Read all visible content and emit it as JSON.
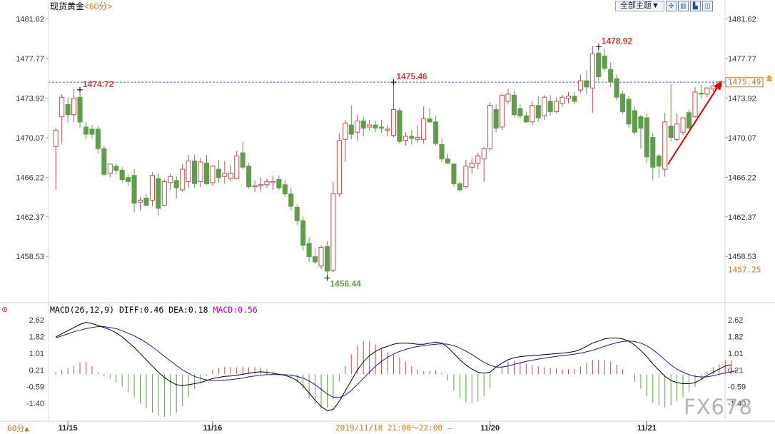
{
  "instrument": {
    "name": "现货黄金",
    "period": "<60分>"
  },
  "toolbar": {
    "theme_label": "全部主题▼",
    "buttons": [
      "✣",
      "▥",
      "▙",
      "◫"
    ]
  },
  "colors": {
    "up": "#c0504d",
    "down": "#5e9e4a",
    "diff": "#000000",
    "dea": "#1a1a9c",
    "macd": "#cc00cc",
    "last_price": "#c8781e",
    "guide": "#3a6fd8",
    "arrow": "#e00000"
  },
  "macd_label": {
    "prefix": "MACD(26,12,9)",
    "diff": "DIFF:0.46",
    "dea": "DEA:0.18",
    "macd": "MACD:0.56"
  },
  "footer": {
    "period_badge": "60分▲",
    "time_range": "2019/11/18 21:00～22:00 —"
  },
  "watermark": "FX678",
  "chart_data": [
    {
      "type": "candlestick",
      "title": "现货黄金",
      "y_ticks": [
        "1481.62",
        "1477.77",
        "1473.92",
        "1470.07",
        "1466.22",
        "1462.37",
        "1458.53"
      ],
      "ylim": [
        1455.7,
        1482.2
      ],
      "x_labels": [
        "11/15",
        "11/16",
        "11/20",
        "11/21"
      ],
      "last_price": "1475.49",
      "lowest_label": "1457.25",
      "reference_line": 1475.46,
      "annotations": [
        {
          "text": "1474.72",
          "value": 1474.72,
          "kind": "high"
        },
        {
          "text": "1475.46",
          "value": 1475.46,
          "kind": "high"
        },
        {
          "text": "1478.92",
          "value": 1478.92,
          "kind": "high"
        },
        {
          "text": "1456.44",
          "value": 1456.44,
          "kind": "low"
        }
      ],
      "candles": [
        {
          "o": 1469.2,
          "h": 1471.0,
          "l": 1465.0,
          "c": 1470.8
        },
        {
          "o": 1472.1,
          "h": 1474.3,
          "l": 1469.5,
          "c": 1474.0
        },
        {
          "o": 1473.3,
          "h": 1474.0,
          "l": 1471.5,
          "c": 1472.3
        },
        {
          "o": 1472.3,
          "h": 1474.8,
          "l": 1471.6,
          "c": 1473.9
        },
        {
          "o": 1474.0,
          "h": 1474.72,
          "l": 1471.0,
          "c": 1471.6
        },
        {
          "o": 1471.1,
          "h": 1471.6,
          "l": 1469.9,
          "c": 1470.4
        },
        {
          "o": 1470.9,
          "h": 1471.3,
          "l": 1470.0,
          "c": 1470.4
        },
        {
          "o": 1470.9,
          "h": 1471.2,
          "l": 1468.5,
          "c": 1469.0
        },
        {
          "o": 1469.0,
          "h": 1469.3,
          "l": 1466.3,
          "c": 1466.5
        },
        {
          "o": 1466.6,
          "h": 1467.5,
          "l": 1466.2,
          "c": 1467.5
        },
        {
          "o": 1467.3,
          "h": 1467.6,
          "l": 1466.5,
          "c": 1466.9
        },
        {
          "o": 1466.9,
          "h": 1467.2,
          "l": 1465.7,
          "c": 1466.0
        },
        {
          "o": 1466.2,
          "h": 1466.5,
          "l": 1465.4,
          "c": 1465.8
        },
        {
          "o": 1466.4,
          "h": 1467.0,
          "l": 1462.8,
          "c": 1463.7
        },
        {
          "o": 1463.8,
          "h": 1464.3,
          "l": 1463.0,
          "c": 1464.0
        },
        {
          "o": 1464.2,
          "h": 1464.6,
          "l": 1463.4,
          "c": 1463.5
        },
        {
          "o": 1464.0,
          "h": 1466.7,
          "l": 1463.4,
          "c": 1466.4
        },
        {
          "o": 1466.1,
          "h": 1466.6,
          "l": 1462.5,
          "c": 1463.2
        },
        {
          "o": 1463.5,
          "h": 1466.0,
          "l": 1463.4,
          "c": 1465.8
        },
        {
          "o": 1465.7,
          "h": 1466.6,
          "l": 1465.0,
          "c": 1466.3
        },
        {
          "o": 1465.9,
          "h": 1466.3,
          "l": 1464.2,
          "c": 1465.2
        },
        {
          "o": 1465.0,
          "h": 1467.5,
          "l": 1464.8,
          "c": 1467.0
        },
        {
          "o": 1465.8,
          "h": 1468.4,
          "l": 1465.2,
          "c": 1467.8
        },
        {
          "o": 1467.8,
          "h": 1468.4,
          "l": 1465.2,
          "c": 1465.6
        },
        {
          "o": 1465.8,
          "h": 1468.1,
          "l": 1465.3,
          "c": 1467.7
        },
        {
          "o": 1467.6,
          "h": 1468.4,
          "l": 1465.5,
          "c": 1465.6
        },
        {
          "o": 1465.7,
          "h": 1467.4,
          "l": 1465.4,
          "c": 1467.3
        },
        {
          "o": 1467.0,
          "h": 1467.9,
          "l": 1465.7,
          "c": 1466.2
        },
        {
          "o": 1466.3,
          "h": 1467.8,
          "l": 1465.6,
          "c": 1466.6
        },
        {
          "o": 1466.1,
          "h": 1467.4,
          "l": 1465.8,
          "c": 1466.6
        },
        {
          "o": 1466.1,
          "h": 1468.8,
          "l": 1466.0,
          "c": 1468.3
        },
        {
          "o": 1468.6,
          "h": 1469.7,
          "l": 1467.0,
          "c": 1467.2
        },
        {
          "o": 1467.3,
          "h": 1467.6,
          "l": 1465.1,
          "c": 1465.3
        },
        {
          "o": 1465.3,
          "h": 1465.9,
          "l": 1464.8,
          "c": 1465.4
        },
        {
          "o": 1465.4,
          "h": 1466.2,
          "l": 1464.9,
          "c": 1465.5
        },
        {
          "o": 1465.5,
          "h": 1466.1,
          "l": 1465.2,
          "c": 1465.8
        },
        {
          "o": 1465.7,
          "h": 1466.3,
          "l": 1465.0,
          "c": 1465.8
        },
        {
          "o": 1466.0,
          "h": 1466.4,
          "l": 1465.0,
          "c": 1465.2
        },
        {
          "o": 1465.5,
          "h": 1466.0,
          "l": 1464.3,
          "c": 1464.6
        },
        {
          "o": 1464.6,
          "h": 1465.2,
          "l": 1463.0,
          "c": 1463.4
        },
        {
          "o": 1463.3,
          "h": 1463.6,
          "l": 1461.6,
          "c": 1462.0
        },
        {
          "o": 1462.0,
          "h": 1462.4,
          "l": 1459.1,
          "c": 1459.6
        },
        {
          "o": 1459.8,
          "h": 1460.4,
          "l": 1458.0,
          "c": 1458.5
        },
        {
          "o": 1458.5,
          "h": 1459.3,
          "l": 1457.8,
          "c": 1458.0
        },
        {
          "o": 1457.6,
          "h": 1459.6,
          "l": 1457.3,
          "c": 1459.4
        },
        {
          "o": 1459.5,
          "h": 1460.0,
          "l": 1456.44,
          "c": 1457.1
        },
        {
          "o": 1457.2,
          "h": 1465.8,
          "l": 1457.0,
          "c": 1464.6
        },
        {
          "o": 1464.6,
          "h": 1470.5,
          "l": 1464.3,
          "c": 1469.8
        },
        {
          "o": 1469.9,
          "h": 1471.8,
          "l": 1467.7,
          "c": 1471.5
        },
        {
          "o": 1471.3,
          "h": 1473.2,
          "l": 1469.9,
          "c": 1470.4
        },
        {
          "o": 1470.6,
          "h": 1472.3,
          "l": 1469.8,
          "c": 1471.7
        },
        {
          "o": 1471.7,
          "h": 1472.1,
          "l": 1470.2,
          "c": 1471.0
        },
        {
          "o": 1471.1,
          "h": 1471.8,
          "l": 1470.8,
          "c": 1471.3
        },
        {
          "o": 1471.3,
          "h": 1471.7,
          "l": 1470.6,
          "c": 1471.0
        },
        {
          "o": 1471.1,
          "h": 1471.8,
          "l": 1470.5,
          "c": 1471.0
        },
        {
          "o": 1470.8,
          "h": 1471.3,
          "l": 1470.2,
          "c": 1470.9
        },
        {
          "o": 1470.3,
          "h": 1475.46,
          "l": 1470.1,
          "c": 1472.8
        },
        {
          "o": 1472.7,
          "h": 1473.0,
          "l": 1469.5,
          "c": 1469.7
        },
        {
          "o": 1469.8,
          "h": 1470.6,
          "l": 1469.3,
          "c": 1470.2
        },
        {
          "o": 1470.2,
          "h": 1470.8,
          "l": 1469.4,
          "c": 1470.0
        },
        {
          "o": 1469.9,
          "h": 1471.3,
          "l": 1469.6,
          "c": 1470.1
        },
        {
          "o": 1469.9,
          "h": 1473.1,
          "l": 1469.5,
          "c": 1471.9
        },
        {
          "o": 1471.9,
          "h": 1472.9,
          "l": 1471.5,
          "c": 1471.6
        },
        {
          "o": 1471.6,
          "h": 1472.2,
          "l": 1469.3,
          "c": 1469.5
        },
        {
          "o": 1469.4,
          "h": 1470.0,
          "l": 1467.7,
          "c": 1468.0
        },
        {
          "o": 1468.0,
          "h": 1468.5,
          "l": 1467.5,
          "c": 1467.6
        },
        {
          "o": 1467.5,
          "h": 1467.6,
          "l": 1465.3,
          "c": 1465.6
        },
        {
          "o": 1465.6,
          "h": 1465.8,
          "l": 1464.8,
          "c": 1465.0
        },
        {
          "o": 1465.3,
          "h": 1467.9,
          "l": 1465.1,
          "c": 1467.3
        },
        {
          "o": 1467.2,
          "h": 1468.1,
          "l": 1466.6,
          "c": 1467.6
        },
        {
          "o": 1467.6,
          "h": 1468.6,
          "l": 1467.0,
          "c": 1468.3
        },
        {
          "o": 1468.0,
          "h": 1469.2,
          "l": 1465.8,
          "c": 1469.0
        },
        {
          "o": 1469.0,
          "h": 1473.5,
          "l": 1468.8,
          "c": 1473.2
        },
        {
          "o": 1472.8,
          "h": 1473.3,
          "l": 1470.6,
          "c": 1471.0
        },
        {
          "o": 1471.1,
          "h": 1474.4,
          "l": 1470.8,
          "c": 1474.2
        },
        {
          "o": 1473.6,
          "h": 1474.8,
          "l": 1473.3,
          "c": 1474.3
        },
        {
          "o": 1474.2,
          "h": 1474.6,
          "l": 1472.1,
          "c": 1472.3
        },
        {
          "o": 1472.9,
          "h": 1473.3,
          "l": 1471.9,
          "c": 1472.2
        },
        {
          "o": 1472.2,
          "h": 1472.6,
          "l": 1471.5,
          "c": 1471.6
        },
        {
          "o": 1471.6,
          "h": 1473.6,
          "l": 1471.3,
          "c": 1473.2
        },
        {
          "o": 1473.2,
          "h": 1474.1,
          "l": 1471.6,
          "c": 1472.0
        },
        {
          "o": 1472.2,
          "h": 1474.2,
          "l": 1471.8,
          "c": 1474.0
        },
        {
          "o": 1473.6,
          "h": 1474.2,
          "l": 1472.2,
          "c": 1472.6
        },
        {
          "o": 1472.6,
          "h": 1474.0,
          "l": 1472.4,
          "c": 1473.6
        },
        {
          "o": 1473.4,
          "h": 1474.2,
          "l": 1473.1,
          "c": 1474.0
        },
        {
          "o": 1473.9,
          "h": 1474.5,
          "l": 1473.4,
          "c": 1474.1
        },
        {
          "o": 1474.1,
          "h": 1474.5,
          "l": 1473.3,
          "c": 1473.6
        },
        {
          "o": 1474.7,
          "h": 1476.2,
          "l": 1474.4,
          "c": 1475.6
        },
        {
          "o": 1475.6,
          "h": 1476.6,
          "l": 1474.3,
          "c": 1475.0
        },
        {
          "o": 1474.9,
          "h": 1479.0,
          "l": 1472.5,
          "c": 1478.2
        },
        {
          "o": 1478.3,
          "h": 1478.92,
          "l": 1475.6,
          "c": 1476.0
        },
        {
          "o": 1478.0,
          "h": 1478.7,
          "l": 1476.5,
          "c": 1476.8
        },
        {
          "o": 1476.7,
          "h": 1477.4,
          "l": 1475.0,
          "c": 1475.5
        },
        {
          "o": 1475.8,
          "h": 1476.2,
          "l": 1473.7,
          "c": 1474.0
        },
        {
          "o": 1474.3,
          "h": 1474.6,
          "l": 1472.4,
          "c": 1472.6
        },
        {
          "o": 1473.8,
          "h": 1474.1,
          "l": 1471.0,
          "c": 1471.4
        },
        {
          "o": 1472.7,
          "h": 1473.1,
          "l": 1470.4,
          "c": 1470.6
        },
        {
          "o": 1472.1,
          "h": 1472.3,
          "l": 1469.0,
          "c": 1471.0
        },
        {
          "o": 1472.0,
          "h": 1472.4,
          "l": 1467.6,
          "c": 1468.2
        },
        {
          "o": 1470.1,
          "h": 1470.5,
          "l": 1466.0,
          "c": 1467.2
        },
        {
          "o": 1468.3,
          "h": 1468.5,
          "l": 1466.2,
          "c": 1467.3
        },
        {
          "o": 1467.0,
          "h": 1472.5,
          "l": 1466.3,
          "c": 1471.6
        },
        {
          "o": 1471.2,
          "h": 1475.3,
          "l": 1469.7,
          "c": 1470.1
        },
        {
          "o": 1469.9,
          "h": 1472.4,
          "l": 1469.7,
          "c": 1471.4
        },
        {
          "o": 1470.6,
          "h": 1472.0,
          "l": 1470.3,
          "c": 1472.0
        },
        {
          "o": 1472.5,
          "h": 1472.8,
          "l": 1470.9,
          "c": 1471.0
        },
        {
          "o": 1472.1,
          "h": 1475.0,
          "l": 1472.0,
          "c": 1474.5
        },
        {
          "o": 1474.4,
          "h": 1475.2,
          "l": 1473.9,
          "c": 1474.3
        },
        {
          "o": 1474.3,
          "h": 1475.0,
          "l": 1474.0,
          "c": 1474.9
        },
        {
          "o": 1474.8,
          "h": 1475.46,
          "l": 1474.5,
          "c": 1475.1
        },
        {
          "o": 1475.0,
          "h": 1475.6,
          "l": 1474.7,
          "c": 1475.49
        }
      ]
    },
    {
      "type": "macd",
      "title": "MACD(26,12,9)",
      "y_ticks": [
        "2.62",
        "1.82",
        "1.01",
        "0.21",
        "-0.59",
        "-1.40"
      ],
      "ylim": [
        -2.05,
        2.9
      ],
      "diff": [
        1.8,
        1.95,
        2.1,
        2.25,
        2.4,
        2.5,
        2.45,
        2.35,
        2.25,
        2.15,
        2.0,
        1.8,
        1.55,
        1.3,
        1.0,
        0.7,
        0.4,
        0.1,
        -0.15,
        -0.35,
        -0.5,
        -0.55,
        -0.5,
        -0.45,
        -0.4,
        -0.3,
        -0.2,
        -0.15,
        -0.1,
        -0.08,
        -0.05,
        0.0,
        0.05,
        0.1,
        0.12,
        0.1,
        0.05,
        0.0,
        -0.05,
        -0.15,
        -0.3,
        -0.55,
        -0.9,
        -1.25,
        -1.55,
        -1.75,
        -1.7,
        -1.3,
        -0.8,
        -0.3,
        0.2,
        0.6,
        0.9,
        1.1,
        1.25,
        1.35,
        1.45,
        1.5,
        1.5,
        1.48,
        1.45,
        1.45,
        1.5,
        1.55,
        1.5,
        1.3,
        1.0,
        0.7,
        0.45,
        0.25,
        0.1,
        0.05,
        0.1,
        0.35,
        0.55,
        0.7,
        0.8,
        0.85,
        0.88,
        0.9,
        0.92,
        0.95,
        0.97,
        1.0,
        1.02,
        1.05,
        1.1,
        1.2,
        1.35,
        1.5,
        1.6,
        1.7,
        1.75,
        1.75,
        1.7,
        1.6,
        1.4,
        1.15,
        0.85,
        0.5,
        0.2,
        -0.1,
        -0.3,
        -0.4,
        -0.45,
        -0.45,
        -0.4,
        -0.25,
        -0.05,
        0.1,
        0.25,
        0.4,
        0.46
      ],
      "dea": [
        1.75,
        1.85,
        1.95,
        2.05,
        2.12,
        2.2,
        2.25,
        2.3,
        2.3,
        2.25,
        2.2,
        2.1,
        1.98,
        1.85,
        1.7,
        1.52,
        1.32,
        1.1,
        0.87,
        0.65,
        0.42,
        0.22,
        0.05,
        -0.1,
        -0.2,
        -0.27,
        -0.3,
        -0.3,
        -0.28,
        -0.26,
        -0.22,
        -0.18,
        -0.12,
        -0.08,
        -0.04,
        -0.02,
        -0.01,
        -0.01,
        -0.02,
        -0.05,
        -0.1,
        -0.18,
        -0.32,
        -0.5,
        -0.72,
        -0.95,
        -1.1,
        -1.12,
        -1.0,
        -0.78,
        -0.5,
        -0.2,
        0.1,
        0.38,
        0.62,
        0.82,
        0.98,
        1.1,
        1.2,
        1.28,
        1.34,
        1.38,
        1.42,
        1.45,
        1.47,
        1.45,
        1.38,
        1.27,
        1.12,
        0.95,
        0.76,
        0.58,
        0.44,
        0.35,
        0.35,
        0.4,
        0.48,
        0.55,
        0.62,
        0.68,
        0.73,
        0.78,
        0.82,
        0.86,
        0.9,
        0.93,
        0.97,
        1.02,
        1.08,
        1.15,
        1.25,
        1.35,
        1.44,
        1.52,
        1.58,
        1.6,
        1.58,
        1.5,
        1.38,
        1.18,
        0.95,
        0.7,
        0.45,
        0.25,
        0.1,
        -0.02,
        -0.1,
        -0.13,
        -0.12,
        -0.07,
        0.0,
        0.06,
        0.12,
        0.18
      ]
    }
  ]
}
